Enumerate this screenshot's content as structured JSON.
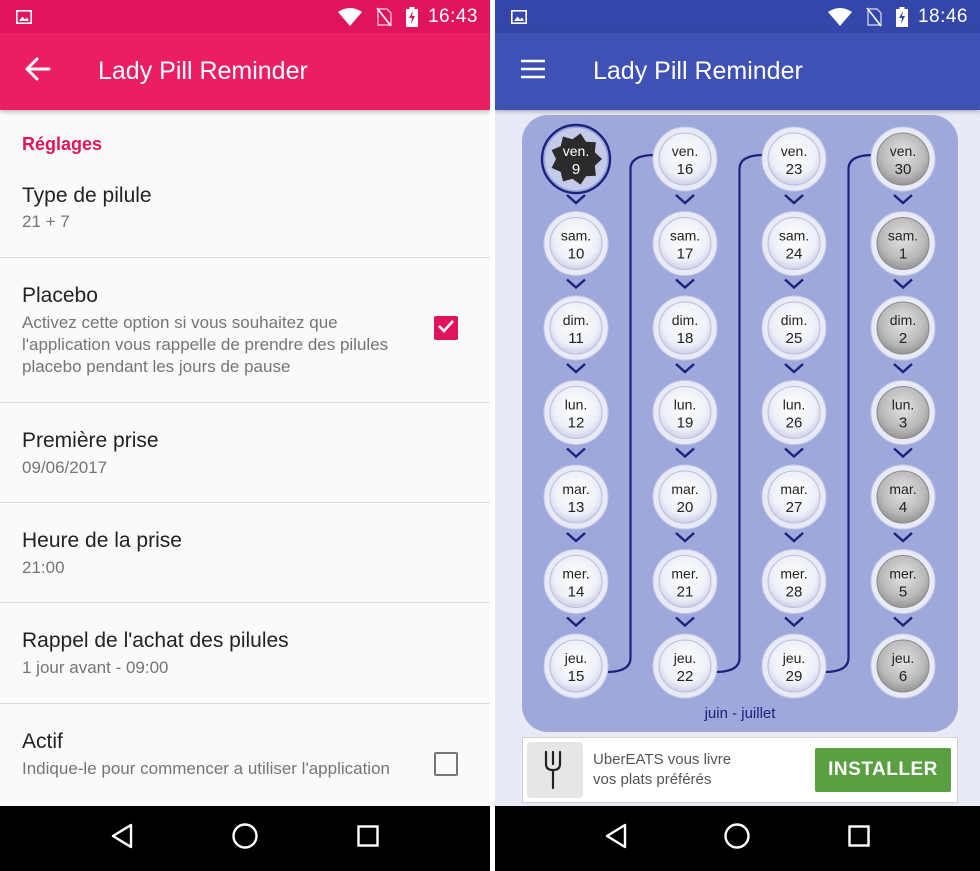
{
  "left": {
    "status_bar": {
      "time": "16:43",
      "color": "#e0145c"
    },
    "app_bar": {
      "title": "Lady Pill Reminder",
      "back_icon": "arrow-back-icon",
      "color": "#ec1e63"
    },
    "section_title": "Réglages",
    "preferences": [
      {
        "title": "Type de pilule",
        "summary": "21 + 7"
      },
      {
        "title": "Placebo",
        "summary": "Activez cette option si vous souhaitez que l'application vous rappelle de prendre des pilules placebo pendant les jours de pause",
        "checked": true
      },
      {
        "title": "Première prise",
        "summary": "09/06/2017"
      },
      {
        "title": "Heure de la prise",
        "summary": "21:00"
      },
      {
        "title": "Rappel de l'achat des pilules",
        "summary": "1 jour avant - 09:00"
      },
      {
        "title": "Actif",
        "summary": "Indique-le pour commencer a utiliser l'application",
        "checked": false
      }
    ]
  },
  "right": {
    "status_bar": {
      "time": "18:46",
      "color": "#3446a9"
    },
    "app_bar": {
      "title": "Lady Pill Reminder",
      "menu_icon": "menu-icon",
      "color": "#3f51b5"
    },
    "pill_pack": {
      "label": "juin - juillet",
      "columns": [
        [
          {
            "day": "ven.",
            "date": "9",
            "state": "taken"
          },
          {
            "day": "sam.",
            "date": "10",
            "state": "active"
          },
          {
            "day": "dim.",
            "date": "11",
            "state": "active"
          },
          {
            "day": "lun.",
            "date": "12",
            "state": "active"
          },
          {
            "day": "mar.",
            "date": "13",
            "state": "active"
          },
          {
            "day": "mer.",
            "date": "14",
            "state": "active"
          },
          {
            "day": "jeu.",
            "date": "15",
            "state": "active"
          }
        ],
        [
          {
            "day": "ven.",
            "date": "16",
            "state": "active"
          },
          {
            "day": "sam.",
            "date": "17",
            "state": "active"
          },
          {
            "day": "dim.",
            "date": "18",
            "state": "active"
          },
          {
            "day": "lun.",
            "date": "19",
            "state": "active"
          },
          {
            "day": "mar.",
            "date": "20",
            "state": "active"
          },
          {
            "day": "mer.",
            "date": "21",
            "state": "active"
          },
          {
            "day": "jeu.",
            "date": "22",
            "state": "active"
          }
        ],
        [
          {
            "day": "ven.",
            "date": "23",
            "state": "active"
          },
          {
            "day": "sam.",
            "date": "24",
            "state": "active"
          },
          {
            "day": "dim.",
            "date": "25",
            "state": "active"
          },
          {
            "day": "lun.",
            "date": "26",
            "state": "active"
          },
          {
            "day": "mar.",
            "date": "27",
            "state": "active"
          },
          {
            "day": "mer.",
            "date": "28",
            "state": "active"
          },
          {
            "day": "jeu.",
            "date": "29",
            "state": "active"
          }
        ],
        [
          {
            "day": "ven.",
            "date": "30",
            "state": "placebo"
          },
          {
            "day": "sam.",
            "date": "1",
            "state": "placebo"
          },
          {
            "day": "dim.",
            "date": "2",
            "state": "placebo"
          },
          {
            "day": "lun.",
            "date": "3",
            "state": "placebo"
          },
          {
            "day": "mar.",
            "date": "4",
            "state": "placebo"
          },
          {
            "day": "mer.",
            "date": "5",
            "state": "placebo"
          },
          {
            "day": "jeu.",
            "date": "6",
            "state": "placebo"
          }
        ]
      ]
    },
    "ad": {
      "line1": "UberEATS vous livre",
      "line2": "vos plats préférés",
      "button": "INSTALLER",
      "logo_icon": "fork-icon",
      "button_color": "#5aa042"
    }
  },
  "nav_icons": [
    "back-triangle-icon",
    "home-circle-icon",
    "recents-square-icon"
  ]
}
